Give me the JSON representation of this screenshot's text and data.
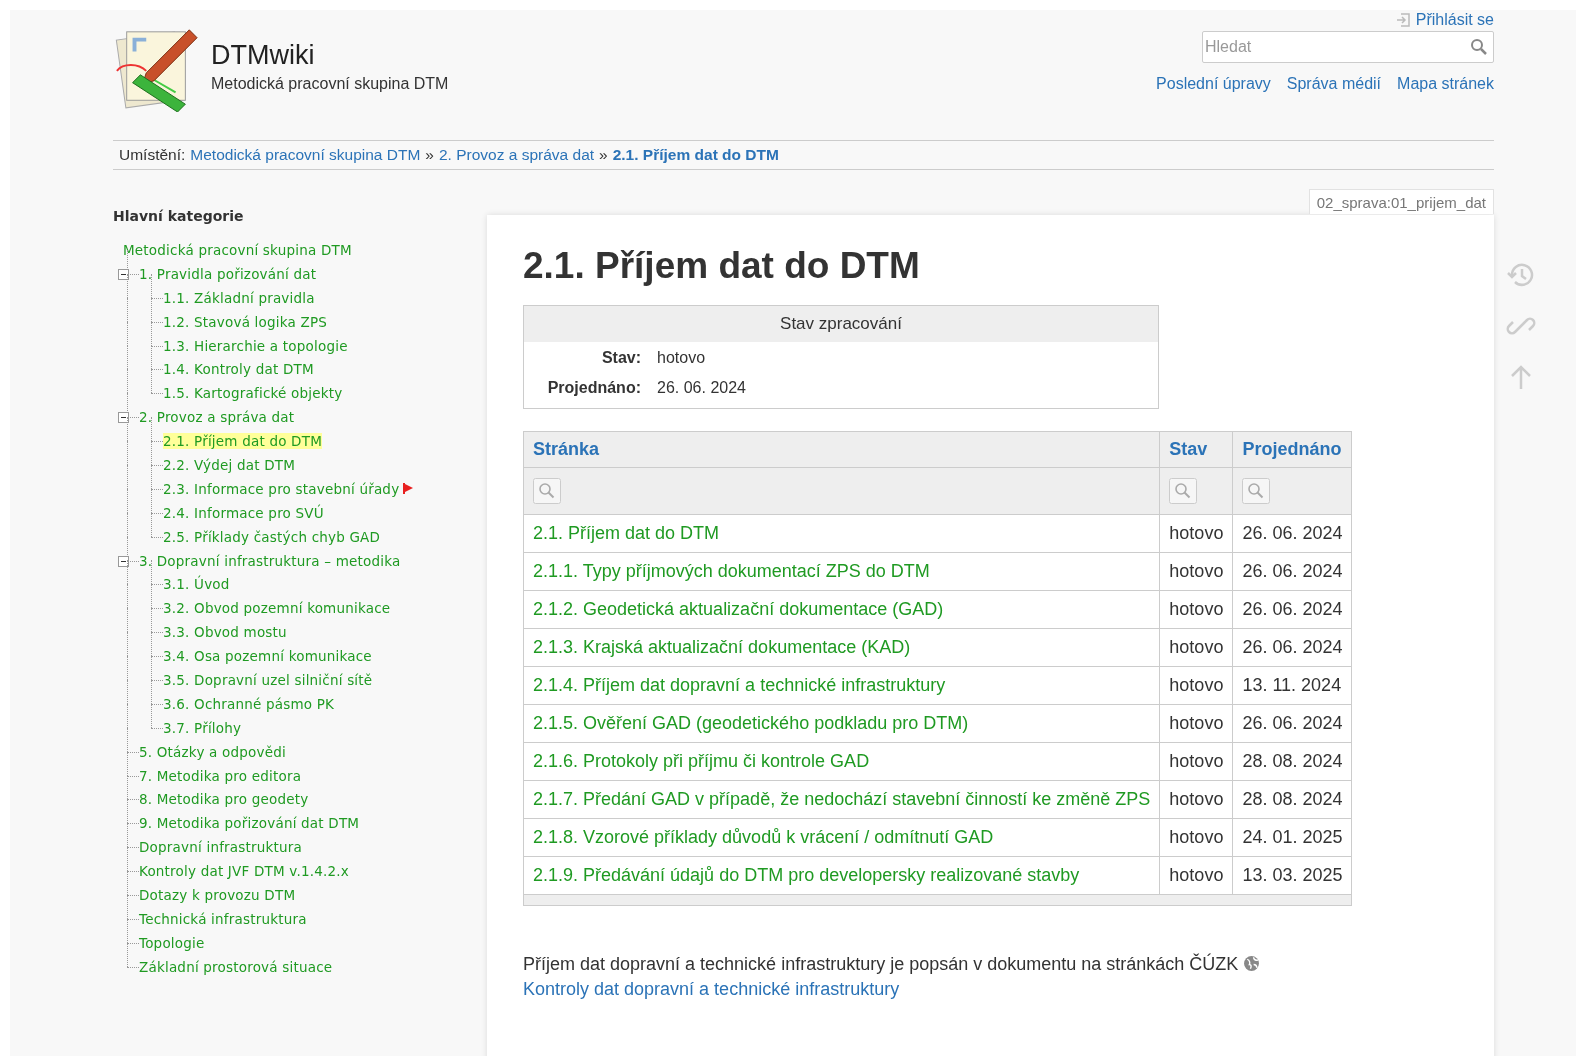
{
  "header": {
    "login": "Přihlásit se",
    "title": "DTMwiki",
    "tagline": "Metodická pracovní skupina DTM",
    "search": {
      "placeholder": "Hledat"
    },
    "links": [
      "Poslední úpravy",
      "Správa médií",
      "Mapa stránek"
    ]
  },
  "breadcrumb": {
    "label": "Umístění:",
    "items": [
      {
        "text": "Metodická pracovní skupina DTM",
        "current": false
      },
      {
        "text": "2. Provoz a správa dat",
        "current": false
      },
      {
        "text": "2.1. Příjem dat do DTM",
        "current": true
      }
    ],
    "separator": "»"
  },
  "sidebar": {
    "title": "Hlavní kategorie",
    "tree": [
      {
        "label": "Metodická pracovní skupina DTM",
        "selected": false,
        "children": [
          {
            "label": "1. Pravidla pořizování dat",
            "selected": false,
            "expanded": true,
            "children": [
              {
                "label": "1.1. Základní pravidla",
                "selected": false,
                "flagged": false
              },
              {
                "label": "1.2. Stavová logika ZPS",
                "selected": false,
                "flagged": false
              },
              {
                "label": "1.3. Hierarchie a topologie",
                "selected": false,
                "flagged": false
              },
              {
                "label": "1.4. Kontroly dat DTM",
                "selected": false,
                "flagged": false
              },
              {
                "label": "1.5. Kartografické objekty",
                "selected": false,
                "flagged": false
              }
            ]
          },
          {
            "label": "2. Provoz a správa dat",
            "selected": false,
            "expanded": true,
            "children": [
              {
                "label": "2.1. Příjem dat do DTM",
                "selected": true,
                "flagged": false
              },
              {
                "label": "2.2. Výdej dat DTM",
                "selected": false,
                "flagged": false
              },
              {
                "label": "2.3. Informace pro stavební úřady",
                "selected": false,
                "flagged": true
              },
              {
                "label": "2.4. Informace pro SVÚ",
                "selected": false,
                "flagged": false
              },
              {
                "label": "2.5. Příklady častých chyb GAD",
                "selected": false,
                "flagged": false
              }
            ]
          },
          {
            "label": "3. Dopravní infrastruktura – metodika",
            "selected": false,
            "expanded": true,
            "children": [
              {
                "label": "3.1. Úvod",
                "selected": false,
                "flagged": false
              },
              {
                "label": "3.2. Obvod pozemní komunikace",
                "selected": false,
                "flagged": false
              },
              {
                "label": "3.3. Obvod mostu",
                "selected": false,
                "flagged": false
              },
              {
                "label": "3.4. Osa pozemní komunikace",
                "selected": false,
                "flagged": false
              },
              {
                "label": "3.5. Dopravní uzel silniční sítě",
                "selected": false,
                "flagged": false
              },
              {
                "label": "3.6. Ochranné pásmo PK",
                "selected": false,
                "flagged": false
              },
              {
                "label": "3.7. Přílohy",
                "selected": false,
                "flagged": false
              }
            ]
          },
          {
            "label": "5. Otázky a odpovědi",
            "selected": false
          },
          {
            "label": "7. Metodika pro editora",
            "selected": false
          },
          {
            "label": "8. Metodika pro geodety",
            "selected": false
          },
          {
            "label": "9. Metodika pořizování dat DTM",
            "selected": false
          },
          {
            "label": "Dopravní infrastruktura",
            "selected": false
          },
          {
            "label": "Kontroly dat JVF DTM v.1.4.2.x",
            "selected": false
          },
          {
            "label": "Dotazy k provozu DTM",
            "selected": false
          },
          {
            "label": "Technická infrastruktura",
            "selected": false
          },
          {
            "label": "Topologie",
            "selected": false
          },
          {
            "label": "Základní prostorová situace",
            "selected": false
          }
        ]
      }
    ]
  },
  "page_id": "02_sprava:01_prijem_dat",
  "page": {
    "title": "2.1. Příjem dat do DTM",
    "status_box": {
      "title": "Stav zpracování",
      "fields": [
        {
          "label": "Stav:",
          "value": "hotovo"
        },
        {
          "label": "Projednáno:",
          "value": "26. 06. 2024"
        }
      ]
    },
    "table": {
      "columns": [
        "Stránka",
        "Stav",
        "Projednáno"
      ],
      "rows": [
        [
          "2.1. Příjem dat do DTM",
          "hotovo",
          "26. 06. 2024"
        ],
        [
          "2.1.1. Typy příjmových dokumentací ZPS do DTM",
          "hotovo",
          "26. 06. 2024"
        ],
        [
          "2.1.2. Geodetická aktualizační dokumentace (GAD)",
          "hotovo",
          "26. 06. 2024"
        ],
        [
          "2.1.3. Krajská aktualizační dokumentace (KAD)",
          "hotovo",
          "26. 06. 2024"
        ],
        [
          "2.1.4. Příjem dat dopravní a technické infrastruktury",
          "hotovo",
          "13. 11. 2024"
        ],
        [
          "2.1.5. Ověření GAD (geodetického podkladu pro DTM)",
          "hotovo",
          "26. 06. 2024"
        ],
        [
          "2.1.6. Protokoly při příjmu či kontrole GAD",
          "hotovo",
          "28. 08. 2024"
        ],
        [
          "2.1.7. Předání GAD v případě, že nedochází stavební činností ke změně ZPS",
          "hotovo",
          "28. 08. 2024"
        ],
        [
          "2.1.8. Vzorové příklady důvodů k vrácení / odmítnutí GAD",
          "hotovo",
          "24. 01. 2025"
        ],
        [
          "2.1.9. Předávání údajů do DTM pro developersky realizované stavby",
          "hotovo",
          "13. 03. 2025"
        ]
      ]
    },
    "paragraph": {
      "text": "Příjem dat dopravní a technické infrastruktury je popsán v dokumentu na stránkách ČÚZK",
      "link": "Kontroly dat dopravní a technické infrastruktury"
    }
  }
}
